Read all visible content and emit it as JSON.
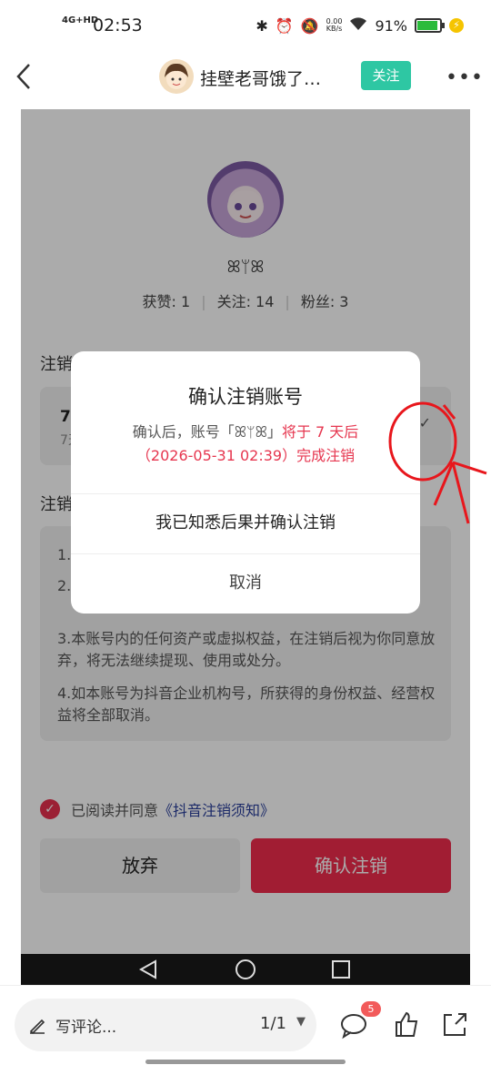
{
  "status_bar": {
    "network": "4G+HD",
    "time": "02:53",
    "speed_value": "0.00",
    "speed_unit": "KB/s",
    "battery": "91%",
    "icons": [
      "bluetooth-icon",
      "alarm-icon",
      "mute-icon",
      "wifi-icon",
      "battery-icon",
      "charging-icon"
    ]
  },
  "header": {
    "title": "挂壁老哥饿了…",
    "follow_label": "关注"
  },
  "profile": {
    "name": "ꕤᛘꕤ",
    "stats": [
      {
        "label": "获赞: 1"
      },
      {
        "label": "关注: 14"
      },
      {
        "label": "粉丝: 3"
      }
    ]
  },
  "background": {
    "section1_label": "注销",
    "option_title": "7天",
    "option_desc": "7天",
    "section2_label": "注销",
    "rules": [
      "1.",
      "2.",
      "3.本账号内的任何资产或虚拟权益，在注销后视为你同意放弃，将无法继续提现、使用或处分。",
      "4.如本账号为抖音企业机构号，所获得的身份权益、经营权益将全部取消。"
    ],
    "agree_prefix": "已阅读并同意",
    "agree_link": "《抖音注销须知》",
    "abandon_label": "放弃",
    "confirm_label": "确认注销"
  },
  "dialog": {
    "title": "确认注销账号",
    "msg_prefix": "确认后，账号「ꕤᛘꕤ」",
    "msg_highlight_1": "将于 7 天后",
    "msg_highlight_2": "（2026-05-31 02:39）完成注销",
    "primary_label": "我已知悉后果并确认注销",
    "cancel_label": "取消"
  },
  "bottom_bar": {
    "comment_placeholder": "写评论...",
    "page_indicator": "1/1",
    "comment_badge": "5"
  },
  "colors": {
    "accent_red": "#f02c4c",
    "follow_green": "#2ec7a3",
    "annotation_red": "#e8161c"
  }
}
